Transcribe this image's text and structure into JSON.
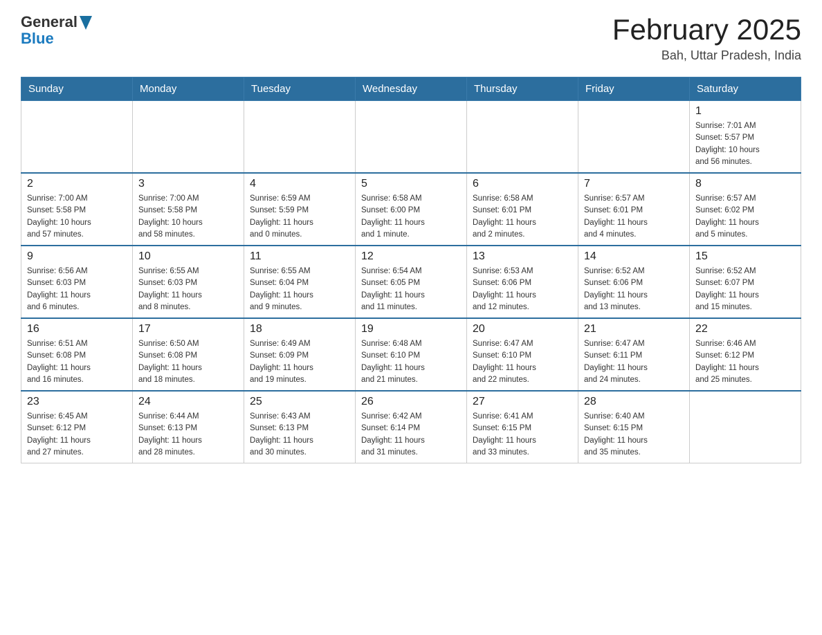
{
  "header": {
    "logo": {
      "general": "General",
      "arrow": "▲",
      "blue": "Blue"
    },
    "title": "February 2025",
    "location": "Bah, Uttar Pradesh, India"
  },
  "calendar": {
    "days_of_week": [
      "Sunday",
      "Monday",
      "Tuesday",
      "Wednesday",
      "Thursday",
      "Friday",
      "Saturday"
    ],
    "weeks": [
      [
        {
          "day": "",
          "info": ""
        },
        {
          "day": "",
          "info": ""
        },
        {
          "day": "",
          "info": ""
        },
        {
          "day": "",
          "info": ""
        },
        {
          "day": "",
          "info": ""
        },
        {
          "day": "",
          "info": ""
        },
        {
          "day": "1",
          "info": "Sunrise: 7:01 AM\nSunset: 5:57 PM\nDaylight: 10 hours\nand 56 minutes."
        }
      ],
      [
        {
          "day": "2",
          "info": "Sunrise: 7:00 AM\nSunset: 5:58 PM\nDaylight: 10 hours\nand 57 minutes."
        },
        {
          "day": "3",
          "info": "Sunrise: 7:00 AM\nSunset: 5:58 PM\nDaylight: 10 hours\nand 58 minutes."
        },
        {
          "day": "4",
          "info": "Sunrise: 6:59 AM\nSunset: 5:59 PM\nDaylight: 11 hours\nand 0 minutes."
        },
        {
          "day": "5",
          "info": "Sunrise: 6:58 AM\nSunset: 6:00 PM\nDaylight: 11 hours\nand 1 minute."
        },
        {
          "day": "6",
          "info": "Sunrise: 6:58 AM\nSunset: 6:01 PM\nDaylight: 11 hours\nand 2 minutes."
        },
        {
          "day": "7",
          "info": "Sunrise: 6:57 AM\nSunset: 6:01 PM\nDaylight: 11 hours\nand 4 minutes."
        },
        {
          "day": "8",
          "info": "Sunrise: 6:57 AM\nSunset: 6:02 PM\nDaylight: 11 hours\nand 5 minutes."
        }
      ],
      [
        {
          "day": "9",
          "info": "Sunrise: 6:56 AM\nSunset: 6:03 PM\nDaylight: 11 hours\nand 6 minutes."
        },
        {
          "day": "10",
          "info": "Sunrise: 6:55 AM\nSunset: 6:03 PM\nDaylight: 11 hours\nand 8 minutes."
        },
        {
          "day": "11",
          "info": "Sunrise: 6:55 AM\nSunset: 6:04 PM\nDaylight: 11 hours\nand 9 minutes."
        },
        {
          "day": "12",
          "info": "Sunrise: 6:54 AM\nSunset: 6:05 PM\nDaylight: 11 hours\nand 11 minutes."
        },
        {
          "day": "13",
          "info": "Sunrise: 6:53 AM\nSunset: 6:06 PM\nDaylight: 11 hours\nand 12 minutes."
        },
        {
          "day": "14",
          "info": "Sunrise: 6:52 AM\nSunset: 6:06 PM\nDaylight: 11 hours\nand 13 minutes."
        },
        {
          "day": "15",
          "info": "Sunrise: 6:52 AM\nSunset: 6:07 PM\nDaylight: 11 hours\nand 15 minutes."
        }
      ],
      [
        {
          "day": "16",
          "info": "Sunrise: 6:51 AM\nSunset: 6:08 PM\nDaylight: 11 hours\nand 16 minutes."
        },
        {
          "day": "17",
          "info": "Sunrise: 6:50 AM\nSunset: 6:08 PM\nDaylight: 11 hours\nand 18 minutes."
        },
        {
          "day": "18",
          "info": "Sunrise: 6:49 AM\nSunset: 6:09 PM\nDaylight: 11 hours\nand 19 minutes."
        },
        {
          "day": "19",
          "info": "Sunrise: 6:48 AM\nSunset: 6:10 PM\nDaylight: 11 hours\nand 21 minutes."
        },
        {
          "day": "20",
          "info": "Sunrise: 6:47 AM\nSunset: 6:10 PM\nDaylight: 11 hours\nand 22 minutes."
        },
        {
          "day": "21",
          "info": "Sunrise: 6:47 AM\nSunset: 6:11 PM\nDaylight: 11 hours\nand 24 minutes."
        },
        {
          "day": "22",
          "info": "Sunrise: 6:46 AM\nSunset: 6:12 PM\nDaylight: 11 hours\nand 25 minutes."
        }
      ],
      [
        {
          "day": "23",
          "info": "Sunrise: 6:45 AM\nSunset: 6:12 PM\nDaylight: 11 hours\nand 27 minutes."
        },
        {
          "day": "24",
          "info": "Sunrise: 6:44 AM\nSunset: 6:13 PM\nDaylight: 11 hours\nand 28 minutes."
        },
        {
          "day": "25",
          "info": "Sunrise: 6:43 AM\nSunset: 6:13 PM\nDaylight: 11 hours\nand 30 minutes."
        },
        {
          "day": "26",
          "info": "Sunrise: 6:42 AM\nSunset: 6:14 PM\nDaylight: 11 hours\nand 31 minutes."
        },
        {
          "day": "27",
          "info": "Sunrise: 6:41 AM\nSunset: 6:15 PM\nDaylight: 11 hours\nand 33 minutes."
        },
        {
          "day": "28",
          "info": "Sunrise: 6:40 AM\nSunset: 6:15 PM\nDaylight: 11 hours\nand 35 minutes."
        },
        {
          "day": "",
          "info": ""
        }
      ]
    ]
  }
}
